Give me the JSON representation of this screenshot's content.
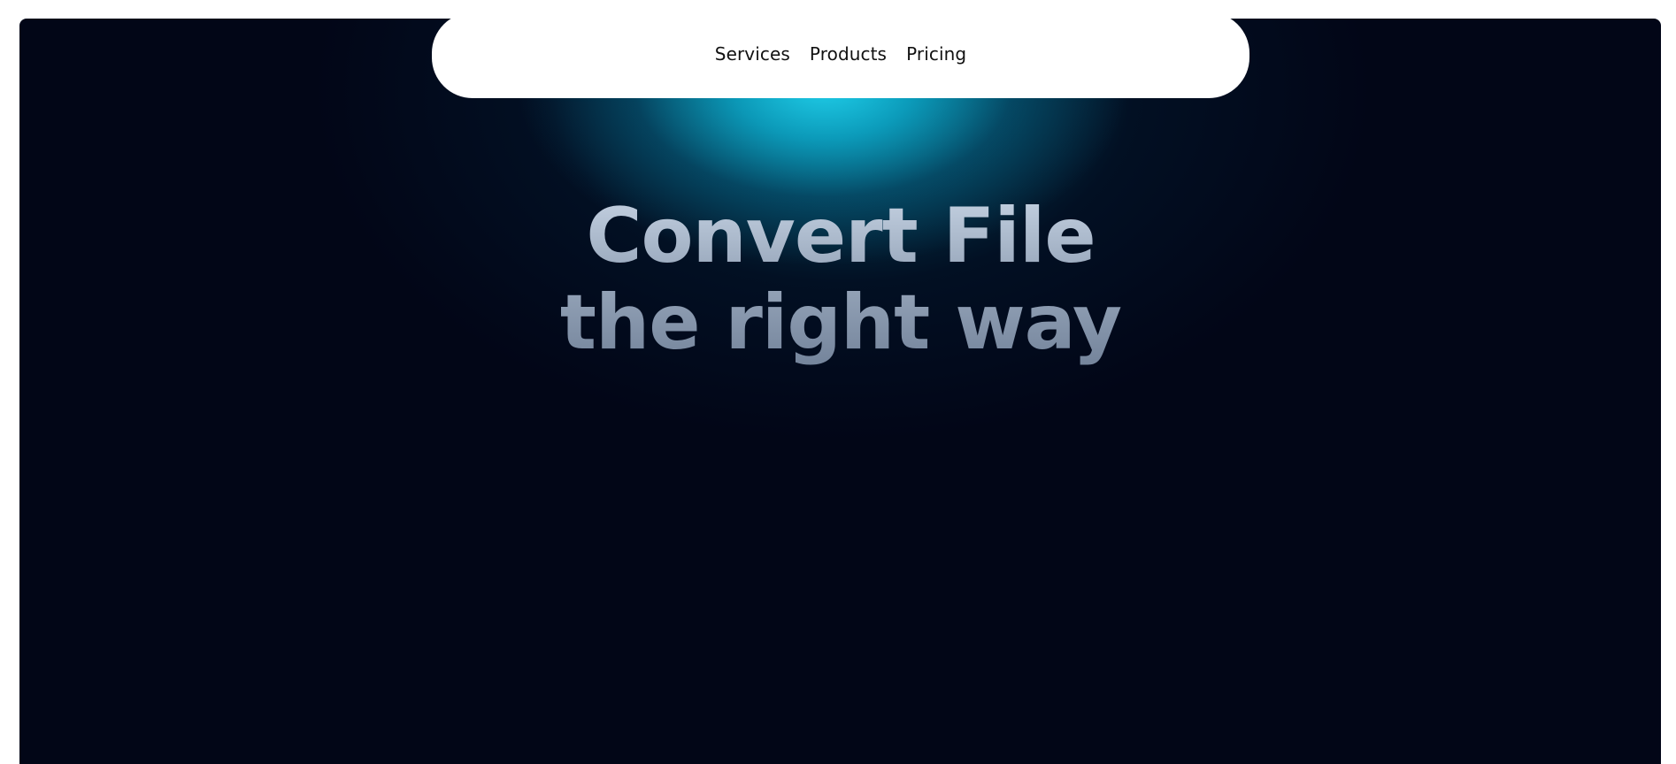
{
  "nav": {
    "items": [
      {
        "label": "Services"
      },
      {
        "label": "Products"
      },
      {
        "label": "Pricing"
      }
    ]
  },
  "hero": {
    "headline_line1": "Convert File",
    "headline_line2": "the right way"
  },
  "colors": {
    "background": "#020617",
    "accent": "#22d3ee",
    "navbar": "#ffffff"
  }
}
